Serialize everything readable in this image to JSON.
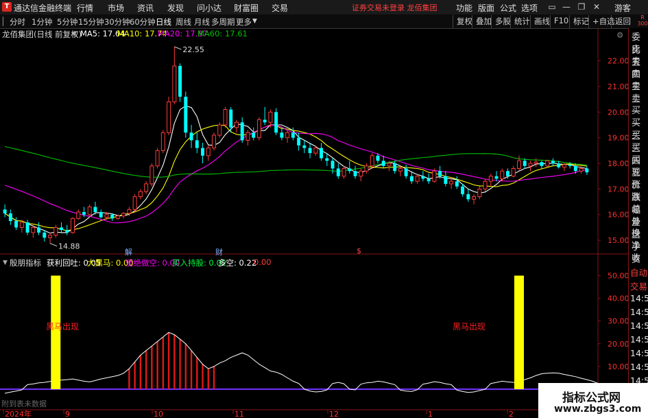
{
  "titlebar": {
    "app_name": "通达信金融终端",
    "menu": [
      "行情",
      "市场",
      "资讯",
      "发现",
      "问小达",
      "财富圈",
      "交易"
    ],
    "notice": "证券交易未登录  龙佰集团",
    "right_menu": [
      "功能",
      "版面",
      "公式",
      "选项"
    ],
    "guest": "游客"
  },
  "toolbar": {
    "periods": [
      "分时",
      "1分钟",
      "5分钟",
      "15分钟",
      "30分钟",
      "60分钟",
      "日线",
      "周线",
      "月线",
      "多周期",
      "更多"
    ],
    "active_period": "日线",
    "right_buttons": [
      "复权",
      "叠加",
      "多股",
      "统计",
      "画线",
      "F10",
      "标记",
      "+自选",
      "返回"
    ]
  },
  "main_legend": {
    "stock": "龙佰集团(日线 前复权)",
    "ma5": "MA5: 17.64",
    "ma10": "MA10: 17.74",
    "ma20": "MA20: 17.87",
    "ma60": "MA60: 17.61"
  },
  "indicator_legend": {
    "name": "殷朋指标",
    "l1": "获利回吐: 0.05",
    "l2": "大黑马: 0.00",
    "l3": "坚绝做空: 0.00",
    "l4": "买入持股: 0.02",
    "l5": "多空: 0.22",
    "l6": "0.00"
  },
  "colors": {
    "up": "#ff3c3c",
    "down": "#00ffff",
    "ma5": "#ffffff",
    "ma10": "#ffff00",
    "ma20": "#ff00ff",
    "ma60": "#00c000",
    "signal": "#ffff00",
    "grid": "#8a1515"
  },
  "side_panel": [
    "委比",
    "卖五",
    "卖四",
    "卖三",
    "卖二",
    "卖一",
    "买一",
    "买二",
    "买三",
    "买四",
    "买五",
    "现价",
    "涨跌",
    "涨幅",
    "总量",
    "外盘",
    "换手",
    "净资",
    "收益"
  ],
  "side_panel_bottom": [
    "自动",
    "交易",
    "14:5",
    "14:5",
    "14:5",
    "14:5",
    "14:5",
    "14:5",
    "14:5"
  ],
  "markers": [
    "解",
    "财",
    "$"
  ],
  "side_corner": "R 300",
  "no_data_text": "附到表未数据",
  "watermark": {
    "line1": "指标公式网",
    "line2": "www.zbgs3.com"
  },
  "chart_data": [
    {
      "type": "candlestick",
      "title": "龙佰集团 日线",
      "y_ticks": [
        22.0,
        21.0,
        20.0,
        19.0,
        18.0,
        17.0,
        16.0,
        15.0
      ],
      "ylim": [
        14.6,
        22.9
      ],
      "x_ticks": [
        "2024年",
        "9",
        "10",
        "11",
        "12",
        "1",
        "2"
      ],
      "annotations": [
        {
          "label": "22.55",
          "kind": "high"
        },
        {
          "label": "14.88",
          "kind": "low"
        }
      ],
      "ohlc": [
        [
          16.2,
          16.4,
          15.9,
          16.05
        ],
        [
          16.05,
          16.2,
          15.6,
          15.75
        ],
        [
          15.75,
          15.9,
          15.4,
          15.5
        ],
        [
          15.5,
          15.8,
          15.3,
          15.7
        ],
        [
          15.7,
          15.8,
          15.2,
          15.3
        ],
        [
          15.3,
          15.6,
          15.1,
          15.5
        ],
        [
          15.5,
          15.7,
          15.2,
          15.3
        ],
        [
          15.3,
          15.4,
          14.95,
          15.1
        ],
        [
          15.1,
          15.3,
          14.88,
          15.2
        ],
        [
          15.2,
          15.6,
          15.1,
          15.5
        ],
        [
          15.5,
          15.7,
          15.3,
          15.4
        ],
        [
          15.4,
          15.6,
          15.2,
          15.3
        ],
        [
          15.3,
          15.9,
          15.25,
          15.85
        ],
        [
          15.85,
          16.2,
          15.8,
          16.1
        ],
        [
          16.1,
          16.3,
          15.9,
          16.0
        ],
        [
          16.0,
          16.4,
          15.95,
          16.3
        ],
        [
          16.3,
          16.5,
          16.0,
          16.1
        ],
        [
          16.1,
          16.2,
          15.85,
          15.9
        ],
        [
          15.9,
          16.1,
          15.8,
          16.0
        ],
        [
          16.0,
          16.05,
          15.75,
          15.85
        ],
        [
          15.85,
          16.0,
          15.8,
          15.95
        ],
        [
          15.95,
          16.1,
          15.85,
          16.05
        ],
        [
          16.05,
          16.3,
          15.95,
          16.2
        ],
        [
          16.2,
          16.8,
          16.1,
          16.7
        ],
        [
          16.7,
          17.0,
          16.6,
          16.9
        ],
        [
          16.9,
          17.3,
          16.8,
          17.2
        ],
        [
          17.2,
          18.0,
          17.1,
          17.9
        ],
        [
          17.9,
          18.6,
          17.8,
          18.5
        ],
        [
          18.5,
          19.3,
          18.4,
          19.2
        ],
        [
          19.2,
          20.6,
          19.1,
          20.4
        ],
        [
          20.4,
          22.55,
          20.3,
          21.8
        ],
        [
          21.8,
          21.9,
          20.4,
          20.6
        ],
        [
          20.6,
          20.8,
          19.0,
          19.2
        ],
        [
          19.2,
          19.5,
          18.6,
          18.9
        ],
        [
          18.9,
          19.2,
          18.4,
          18.6
        ],
        [
          18.6,
          18.8,
          18.0,
          18.3
        ],
        [
          18.3,
          18.7,
          18.1,
          18.6
        ],
        [
          18.6,
          19.2,
          18.5,
          19.1
        ],
        [
          19.1,
          19.6,
          19.0,
          19.5
        ],
        [
          19.5,
          20.2,
          19.4,
          20.1
        ],
        [
          20.1,
          20.2,
          19.2,
          19.4
        ],
        [
          19.4,
          19.7,
          19.2,
          19.6
        ],
        [
          19.6,
          19.8,
          18.8,
          18.9
        ],
        [
          18.9,
          19.3,
          18.7,
          19.2
        ],
        [
          19.2,
          19.4,
          18.9,
          19.0
        ],
        [
          19.0,
          19.8,
          18.9,
          19.7
        ],
        [
          19.7,
          20.2,
          19.5,
          19.6
        ],
        [
          19.6,
          20.1,
          19.4,
          20.0
        ],
        [
          20.0,
          20.15,
          19.1,
          19.2
        ],
        [
          19.2,
          19.4,
          18.9,
          19.0
        ],
        [
          19.0,
          19.3,
          18.8,
          19.2
        ],
        [
          19.2,
          19.4,
          18.9,
          19.0
        ],
        [
          19.0,
          19.2,
          18.5,
          18.7
        ],
        [
          18.7,
          18.9,
          18.4,
          18.6
        ],
        [
          18.6,
          18.8,
          18.2,
          18.4
        ],
        [
          18.4,
          18.7,
          18.3,
          18.6
        ],
        [
          18.6,
          18.8,
          18.1,
          18.2
        ],
        [
          18.2,
          18.4,
          17.9,
          18.1
        ],
        [
          18.1,
          18.2,
          17.6,
          17.8
        ],
        [
          17.8,
          18.0,
          17.4,
          17.5
        ],
        [
          17.5,
          17.9,
          17.4,
          17.8
        ],
        [
          17.8,
          18.1,
          17.6,
          17.7
        ],
        [
          17.7,
          17.9,
          17.4,
          17.5
        ],
        [
          17.5,
          17.8,
          17.3,
          17.7
        ],
        [
          17.7,
          18.0,
          17.6,
          17.9
        ],
        [
          17.9,
          18.4,
          17.8,
          18.3
        ],
        [
          18.3,
          18.4,
          18.0,
          18.1
        ],
        [
          18.1,
          18.3,
          17.8,
          17.9
        ],
        [
          17.9,
          18.1,
          17.7,
          18.0
        ],
        [
          18.0,
          18.1,
          17.6,
          17.7
        ],
        [
          17.7,
          17.9,
          17.5,
          17.8
        ],
        [
          17.8,
          17.95,
          17.4,
          17.5
        ],
        [
          17.5,
          17.7,
          17.2,
          17.3
        ],
        [
          17.3,
          17.6,
          17.2,
          17.5
        ],
        [
          17.5,
          17.7,
          17.3,
          17.4
        ],
        [
          17.4,
          17.6,
          17.2,
          17.3
        ],
        [
          17.3,
          17.8,
          17.25,
          17.7
        ],
        [
          17.7,
          17.9,
          17.4,
          17.5
        ],
        [
          17.5,
          17.7,
          17.1,
          17.2
        ],
        [
          17.2,
          17.4,
          17.0,
          17.3
        ],
        [
          17.3,
          17.5,
          17.0,
          17.1
        ],
        [
          17.1,
          17.2,
          16.7,
          16.8
        ],
        [
          16.8,
          17.0,
          16.5,
          16.6
        ],
        [
          16.6,
          16.8,
          16.4,
          16.7
        ],
        [
          16.7,
          17.1,
          16.6,
          17.0
        ],
        [
          17.0,
          17.4,
          16.9,
          17.3
        ],
        [
          17.3,
          17.6,
          17.1,
          17.5
        ],
        [
          17.5,
          17.7,
          17.3,
          17.4
        ],
        [
          17.4,
          17.8,
          17.3,
          17.7
        ],
        [
          17.7,
          17.8,
          17.4,
          17.5
        ],
        [
          17.5,
          17.9,
          17.45,
          17.8
        ],
        [
          17.8,
          18.3,
          17.7,
          18.1
        ],
        [
          18.1,
          18.2,
          17.8,
          17.9
        ],
        [
          17.9,
          18.1,
          17.7,
          18.0
        ],
        [
          18.0,
          18.2,
          17.85,
          18.05
        ],
        [
          18.05,
          18.1,
          17.8,
          17.9
        ],
        [
          17.9,
          18.15,
          17.85,
          18.1
        ],
        [
          18.1,
          18.2,
          17.9,
          18.0
        ],
        [
          18.0,
          18.1,
          17.8,
          17.85
        ],
        [
          17.85,
          18.0,
          17.7,
          17.95
        ],
        [
          17.95,
          18.05,
          17.8,
          17.9
        ],
        [
          17.9,
          18.0,
          17.6,
          17.7
        ],
        [
          17.7,
          17.9,
          17.6,
          17.8
        ],
        [
          17.8,
          17.9,
          17.55,
          17.65
        ]
      ]
    },
    {
      "type": "indicator",
      "y_ticks": [
        50.0,
        40.0,
        30.0,
        20.0,
        10.0
      ],
      "ylim": [
        0,
        55
      ],
      "signal_label": "黑马出现",
      "signal_bars": [
        {
          "x_index": 9,
          "value": 50
        },
        {
          "x_index": 91,
          "value": 50
        }
      ],
      "line": [
        0,
        0.5,
        1,
        1.5,
        2,
        2.3,
        2.8,
        3.0,
        3.4,
        3.8,
        4.0,
        4.2,
        4.5,
        4.0,
        3.5,
        3.2,
        3.8,
        4.5,
        5.0,
        5.5,
        6,
        7,
        9,
        12,
        15,
        17,
        19,
        21,
        23,
        25,
        24,
        22,
        20,
        17,
        14,
        11,
        9,
        10,
        11.5,
        12.5,
        14,
        15,
        16,
        15,
        13,
        11,
        9.5,
        8,
        7.5,
        6.5,
        5.0,
        3.5,
        2.5,
        1.8,
        1.0,
        0.6,
        0.8,
        1.5,
        2.5,
        3.0,
        2.4,
        1.8,
        1.5,
        2.2,
        2.8,
        3.0,
        3.5,
        3.2,
        2.6,
        2.0,
        1.4,
        1.0,
        0.8,
        1.6,
        2.2,
        2.7,
        3.3,
        3.0,
        2.4,
        2.0,
        1.4,
        0.8,
        0.4,
        0.6,
        1.2,
        1.8,
        2.5,
        3.0,
        3.5,
        3.2,
        3.0,
        3.6,
        4.2,
        5.0,
        6.0,
        6.8,
        7.0,
        7.2,
        7.0,
        6.5,
        6.0,
        5.5,
        4.8,
        4.2,
        3.5,
        2.5,
        1.5
      ]
    }
  ]
}
